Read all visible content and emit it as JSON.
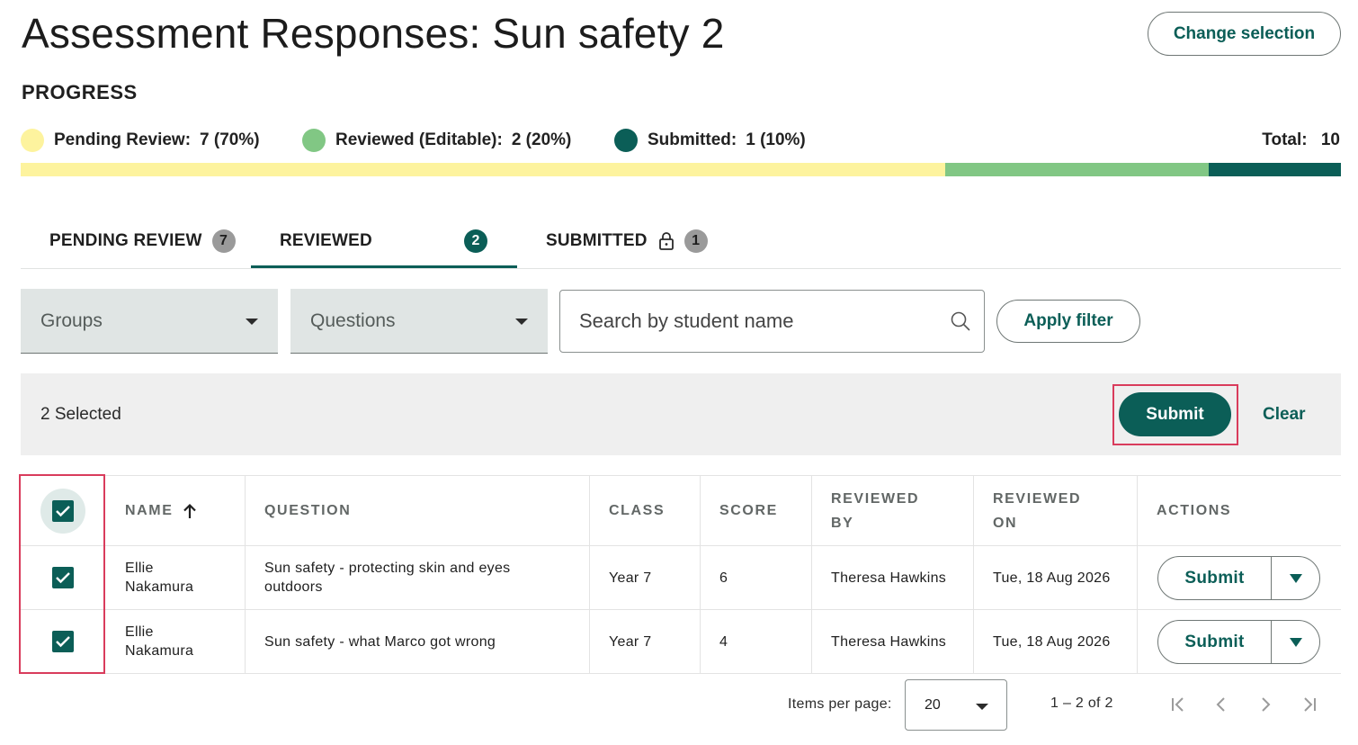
{
  "header": {
    "title": "Assessment Responses: Sun safety 2",
    "change_selection_label": "Change selection"
  },
  "progress": {
    "heading": "PROGRESS",
    "legend": [
      {
        "label": "Pending Review:",
        "value": "7 (70%)",
        "color": "#fdf39e",
        "fraction": 0.7
      },
      {
        "label": "Reviewed (Editable):",
        "value": "2 (20%)",
        "color": "#81c784",
        "fraction": 0.2
      },
      {
        "label": "Submitted:",
        "value": "1 (10%)",
        "color": "#0b5e57",
        "fraction": 0.1
      }
    ],
    "total_label": "Total:",
    "total_value": "10"
  },
  "tabs": [
    {
      "label": "PENDING REVIEW",
      "count": "7",
      "active": false
    },
    {
      "label": "REVIEWED",
      "count": "2",
      "active": true
    },
    {
      "label": "SUBMITTED",
      "count": "1",
      "active": false,
      "icon": "lock-icon"
    }
  ],
  "filters": {
    "groups_label": "Groups",
    "questions_label": "Questions",
    "search_placeholder": "Search by student name",
    "apply_label": "Apply filter"
  },
  "selection_bar": {
    "count_text": "2 Selected",
    "submit_label": "Submit",
    "clear_label": "Clear"
  },
  "table": {
    "headers": {
      "name": "NAME",
      "question": "QUESTION",
      "class": "CLASS",
      "score": "SCORE",
      "reviewed_by_1": "REVIEWED",
      "reviewed_by_2": "BY",
      "reviewed_on_1": "REVIEWED",
      "reviewed_on_2": "ON",
      "actions": "ACTIONS"
    },
    "rows": [
      {
        "name_first": "Ellie",
        "name_last": "Nakamura",
        "question": "Sun safety - protecting skin and eyes outdoors",
        "class": "Year 7",
        "score": "6",
        "reviewed_by": "Theresa Hawkins",
        "reviewed_on": "Tue, 18 Aug 2026",
        "action_label": "Submit",
        "checked": true
      },
      {
        "name_first": "Ellie",
        "name_last": "Nakamura",
        "question": "Sun safety - what Marco got wrong",
        "class": "Year 7",
        "score": "4",
        "reviewed_by": "Theresa Hawkins",
        "reviewed_on": "Tue, 18 Aug 2026",
        "action_label": "Submit",
        "checked": true
      }
    ]
  },
  "pagination": {
    "items_per_page_label": "Items per page:",
    "items_per_page_value": "20",
    "range_text": "1 – 2 of 2"
  },
  "colors": {
    "accent": "#0b5e57",
    "highlight": "#d93c5c"
  }
}
